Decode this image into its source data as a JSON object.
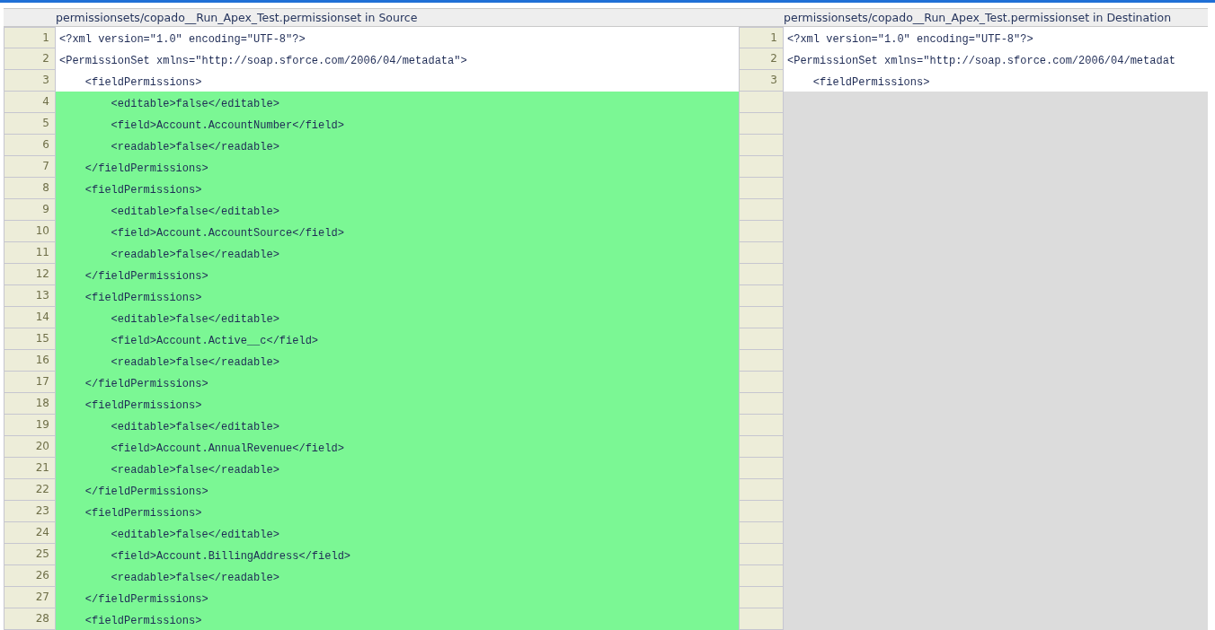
{
  "headers": {
    "source": "permissionsets/copado__Run_Apex_Test.permissionset in Source",
    "destination": "permissionsets/copado__Run_Apex_Test.permissionset in Destination"
  },
  "rows": [
    {
      "kind": "same",
      "left_num": "1",
      "left_code": "<?xml version=\"1.0\" encoding=\"UTF-8\"?>",
      "right_num": "1",
      "right_code": "<?xml version=\"1.0\" encoding=\"UTF-8\"?>"
    },
    {
      "kind": "same",
      "left_num": "2",
      "left_code": "<PermissionSet xmlns=\"http://soap.sforce.com/2006/04/metadata\">",
      "right_num": "2",
      "right_code": "<PermissionSet xmlns=\"http://soap.sforce.com/2006/04/metadat"
    },
    {
      "kind": "same",
      "left_num": "3",
      "left_code": "    <fieldPermissions>",
      "right_num": "3",
      "right_code": "    <fieldPermissions>"
    },
    {
      "kind": "added",
      "left_num": "4",
      "left_code": "        <editable>false</editable>"
    },
    {
      "kind": "added",
      "left_num": "5",
      "left_code": "        <field>Account.AccountNumber</field>"
    },
    {
      "kind": "added",
      "left_num": "6",
      "left_code": "        <readable>false</readable>"
    },
    {
      "kind": "added",
      "left_num": "7",
      "left_code": "    </fieldPermissions>"
    },
    {
      "kind": "added",
      "left_num": "8",
      "left_code": "    <fieldPermissions>"
    },
    {
      "kind": "added",
      "left_num": "9",
      "left_code": "        <editable>false</editable>"
    },
    {
      "kind": "added",
      "left_num": "10",
      "left_code": "        <field>Account.AccountSource</field>"
    },
    {
      "kind": "added",
      "left_num": "11",
      "left_code": "        <readable>false</readable>"
    },
    {
      "kind": "added",
      "left_num": "12",
      "left_code": "    </fieldPermissions>"
    },
    {
      "kind": "added",
      "left_num": "13",
      "left_code": "    <fieldPermissions>"
    },
    {
      "kind": "added",
      "left_num": "14",
      "left_code": "        <editable>false</editable>"
    },
    {
      "kind": "added",
      "left_num": "15",
      "left_code": "        <field>Account.Active__c</field>"
    },
    {
      "kind": "added",
      "left_num": "16",
      "left_code": "        <readable>false</readable>"
    },
    {
      "kind": "added",
      "left_num": "17",
      "left_code": "    </fieldPermissions>"
    },
    {
      "kind": "added",
      "left_num": "18",
      "left_code": "    <fieldPermissions>"
    },
    {
      "kind": "added",
      "left_num": "19",
      "left_code": "        <editable>false</editable>"
    },
    {
      "kind": "added",
      "left_num": "20",
      "left_code": "        <field>Account.AnnualRevenue</field>"
    },
    {
      "kind": "added",
      "left_num": "21",
      "left_code": "        <readable>false</readable>"
    },
    {
      "kind": "added",
      "left_num": "22",
      "left_code": "    </fieldPermissions>"
    },
    {
      "kind": "added",
      "left_num": "23",
      "left_code": "    <fieldPermissions>"
    },
    {
      "kind": "added",
      "left_num": "24",
      "left_code": "        <editable>false</editable>"
    },
    {
      "kind": "added",
      "left_num": "25",
      "left_code": "        <field>Account.BillingAddress</field>"
    },
    {
      "kind": "added",
      "left_num": "26",
      "left_code": "        <readable>false</readable>"
    },
    {
      "kind": "added",
      "left_num": "27",
      "left_code": "    </fieldPermissions>"
    },
    {
      "kind": "added",
      "left_num": "28",
      "left_code": "    <fieldPermissions>"
    }
  ]
}
